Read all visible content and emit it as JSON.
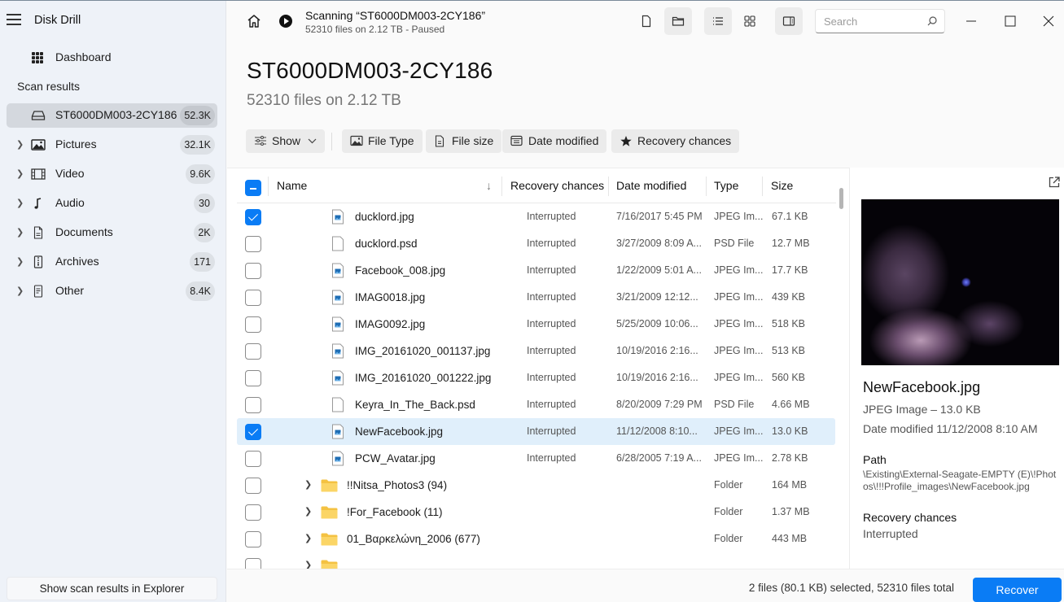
{
  "app": {
    "title": "Disk Drill"
  },
  "sidebar": {
    "dashboard_label": "Dashboard",
    "scan_results_title": "Scan results",
    "items": [
      {
        "label": "ST6000DM003-2CY186",
        "count": "52.3K",
        "icon": "drive-icon",
        "active": true,
        "expandable": false
      },
      {
        "label": "Pictures",
        "count": "32.1K",
        "icon": "picture-icon",
        "active": false,
        "expandable": true
      },
      {
        "label": "Video",
        "count": "9.6K",
        "icon": "film-icon",
        "active": false,
        "expandable": true
      },
      {
        "label": "Audio",
        "count": "30",
        "icon": "music-note-icon",
        "active": false,
        "expandable": true
      },
      {
        "label": "Documents",
        "count": "2K",
        "icon": "document-icon",
        "active": false,
        "expandable": true
      },
      {
        "label": "Archives",
        "count": "171",
        "icon": "archive-icon",
        "active": false,
        "expandable": true
      },
      {
        "label": "Other",
        "count": "8.4K",
        "icon": "other-file-icon",
        "active": false,
        "expandable": true
      }
    ],
    "explorer_button": "Show scan results in Explorer"
  },
  "header": {
    "scan_title": "Scanning “ST6000DM003-2CY186”",
    "scan_subtitle": "52310 files on 2.12 TB - Paused",
    "search_placeholder": "Search",
    "page_title": "ST6000DM003-2CY186",
    "page_subtitle": "52310 files on 2.12 TB"
  },
  "filters": {
    "show": "Show",
    "file_type": "File Type",
    "file_size": "File size",
    "date_modified": "Date modified",
    "recovery_chances": "Recovery chances"
  },
  "table": {
    "columns": {
      "name": "Name",
      "recovery": "Recovery chances",
      "date": "Date modified",
      "type": "Type",
      "size": "Size"
    },
    "sort_indicator": "↓",
    "rows": [
      {
        "name": "ducklord.jpg",
        "kind": "image",
        "recovery": "Interrupted",
        "date": "7/16/2017 5:45 PM",
        "type": "JPEG Im...",
        "size": "67.1 KB",
        "checked": true,
        "selected": false
      },
      {
        "name": "ducklord.psd",
        "kind": "blank",
        "recovery": "Interrupted",
        "date": "3/27/2009 8:09 A...",
        "type": "PSD File",
        "size": "12.7 MB",
        "checked": false,
        "selected": false
      },
      {
        "name": "Facebook_008.jpg",
        "kind": "image",
        "recovery": "Interrupted",
        "date": "1/22/2009 5:01 A...",
        "type": "JPEG Im...",
        "size": "17.7 KB",
        "checked": false,
        "selected": false
      },
      {
        "name": "IMAG0018.jpg",
        "kind": "image",
        "recovery": "Interrupted",
        "date": "3/21/2009 12:12...",
        "type": "JPEG Im...",
        "size": "439 KB",
        "checked": false,
        "selected": false
      },
      {
        "name": "IMAG0092.jpg",
        "kind": "image",
        "recovery": "Interrupted",
        "date": "5/25/2009 10:06...",
        "type": "JPEG Im...",
        "size": "518 KB",
        "checked": false,
        "selected": false
      },
      {
        "name": "IMG_20161020_001137.jpg",
        "kind": "image",
        "recovery": "Interrupted",
        "date": "10/19/2016 2:16...",
        "type": "JPEG Im...",
        "size": "513 KB",
        "checked": false,
        "selected": false
      },
      {
        "name": "IMG_20161020_001222.jpg",
        "kind": "image",
        "recovery": "Interrupted",
        "date": "10/19/2016 2:16...",
        "type": "JPEG Im...",
        "size": "560 KB",
        "checked": false,
        "selected": false
      },
      {
        "name": "Keyra_In_The_Back.psd",
        "kind": "blank",
        "recovery": "Interrupted",
        "date": "8/20/2009 7:29 PM",
        "type": "PSD File",
        "size": "4.66 MB",
        "checked": false,
        "selected": false
      },
      {
        "name": "NewFacebook.jpg",
        "kind": "image",
        "recovery": "Interrupted",
        "date": "11/12/2008 8:10...",
        "type": "JPEG Im...",
        "size": "13.0 KB",
        "checked": true,
        "selected": true
      },
      {
        "name": "PCW_Avatar.jpg",
        "kind": "image",
        "recovery": "Interrupted",
        "date": "6/28/2005 7:19 A...",
        "type": "JPEG Im...",
        "size": "2.78 KB",
        "checked": false,
        "selected": false
      },
      {
        "name": "!!Nitsa_Photos3 (94)",
        "kind": "folder",
        "recovery": "",
        "date": "",
        "type": "Folder",
        "size": "164 MB",
        "checked": false,
        "selected": false
      },
      {
        "name": "!For_Facebook (11)",
        "kind": "folder",
        "recovery": "",
        "date": "",
        "type": "Folder",
        "size": "1.37 MB",
        "checked": false,
        "selected": false
      },
      {
        "name": "01_Βαρκελώνη_2006 (677)",
        "kind": "folder",
        "recovery": "",
        "date": "",
        "type": "Folder",
        "size": "443 MB",
        "checked": false,
        "selected": false
      },
      {
        "name": "",
        "kind": "folder",
        "recovery": "",
        "date": "",
        "type": "",
        "size": "",
        "checked": false,
        "selected": false
      }
    ]
  },
  "preview": {
    "file_name": "NewFacebook.jpg",
    "type_size": "JPEG Image – 13.0 KB",
    "date_modified": "Date modified 11/12/2008 8:10 AM",
    "path_label": "Path",
    "path_value": "\\Existing\\External-Seagate-EMPTY (E)\\!Photos\\!!!Profile_images\\NewFacebook.jpg",
    "recovery_label": "Recovery chances",
    "recovery_value": "Interrupted"
  },
  "footer": {
    "selection_status": "2 files (80.1 KB) selected, 52310 files total",
    "recover_button": "Recover"
  },
  "colors": {
    "accent": "#0a7cf5",
    "selected_row": "#e0effb",
    "sidebar_bg": "#eef2f8"
  }
}
